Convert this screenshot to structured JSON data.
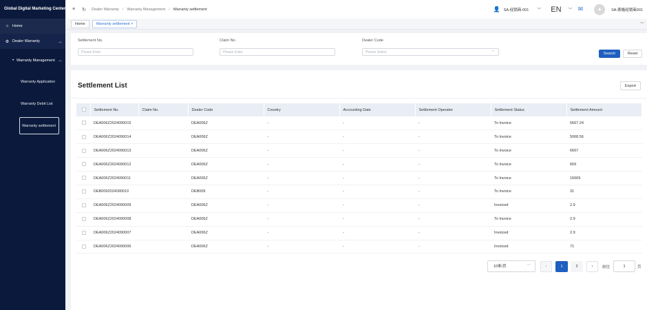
{
  "app": {
    "title": "Global Digital Marketing Center"
  },
  "sidebar": {
    "home": "Home",
    "group": "Dealer Warranty",
    "subgroup": "Warranty Management",
    "items": [
      {
        "label": "Warranty Application"
      },
      {
        "label": "Warranty Debit List"
      },
      {
        "label": "Warranty settlement"
      }
    ]
  },
  "header": {
    "breadcrumb": [
      "Dealer Warranty",
      "Warranty Management",
      "Warranty settlement"
    ],
    "dealer": "SA-经销商-001",
    "language": "EN",
    "account": "SA-索格经销商001"
  },
  "tabs": [
    "Home",
    "Warranty settlement"
  ],
  "filters": {
    "settlement_no": {
      "label": "Settlement No.",
      "placeholder": "Please Enter"
    },
    "claim_no": {
      "label": "Claim No.",
      "placeholder": "Please Enter"
    },
    "dealer_code": {
      "label": "Dealer Code",
      "placeholder": "Please Select"
    },
    "search": "Search",
    "reset": "Reset"
  },
  "list": {
    "title": "Settlement List",
    "export": "Export",
    "columns": [
      "Settlement No.",
      "Claim No.",
      "Dealer Code",
      "Country",
      "Accounting Date",
      "Settlement Operator",
      "Settlement Status",
      "Settlement Amount"
    ],
    "rows": [
      [
        "DEA006Z2024090015",
        "",
        "DEA006Z",
        "-",
        "-",
        "-",
        "To Invoice",
        "5667.24"
      ],
      [
        "DEA006Z2024090014",
        "",
        "DEA006Z",
        "-",
        "-",
        "-",
        "To Invoice",
        "5068.56"
      ],
      [
        "DEA006Z2024090013",
        "",
        "DEA006Z",
        "-",
        "-",
        "-",
        "To Invoice",
        "6667"
      ],
      [
        "DEA006Z2024090012",
        "",
        "DEA006Z",
        "-",
        "-",
        "-",
        "To Invoice",
        "669"
      ],
      [
        "DEA006Z2024090011",
        "",
        "DEA006Z",
        "-",
        "-",
        "-",
        "To Invoice",
        "16669"
      ],
      [
        "DEB0092024090010",
        "",
        "DEB009",
        "-",
        "-",
        "-",
        "To Invoice",
        "31"
      ],
      [
        "DEA006Z2024090009",
        "",
        "DEA006Z",
        "-",
        "-",
        "-",
        "Invoiced",
        "2.9"
      ],
      [
        "DEA006Z2024090008",
        "",
        "DEA006Z",
        "-",
        "-",
        "-",
        "To Invoice",
        "2.9"
      ],
      [
        "DEA006Z2024090007",
        "",
        "DEA006Z",
        "-",
        "-",
        "-",
        "Invoiced",
        "2.9"
      ],
      [
        "DEA006Z2024090006",
        "",
        "DEA006Z",
        "-",
        "-",
        "-",
        "Invoiced",
        "71"
      ]
    ]
  },
  "pagination": {
    "page_size": "10条/页",
    "pages": [
      "1",
      "2"
    ],
    "goto_label": "前往",
    "goto_value": "1",
    "page_unit": "页"
  }
}
